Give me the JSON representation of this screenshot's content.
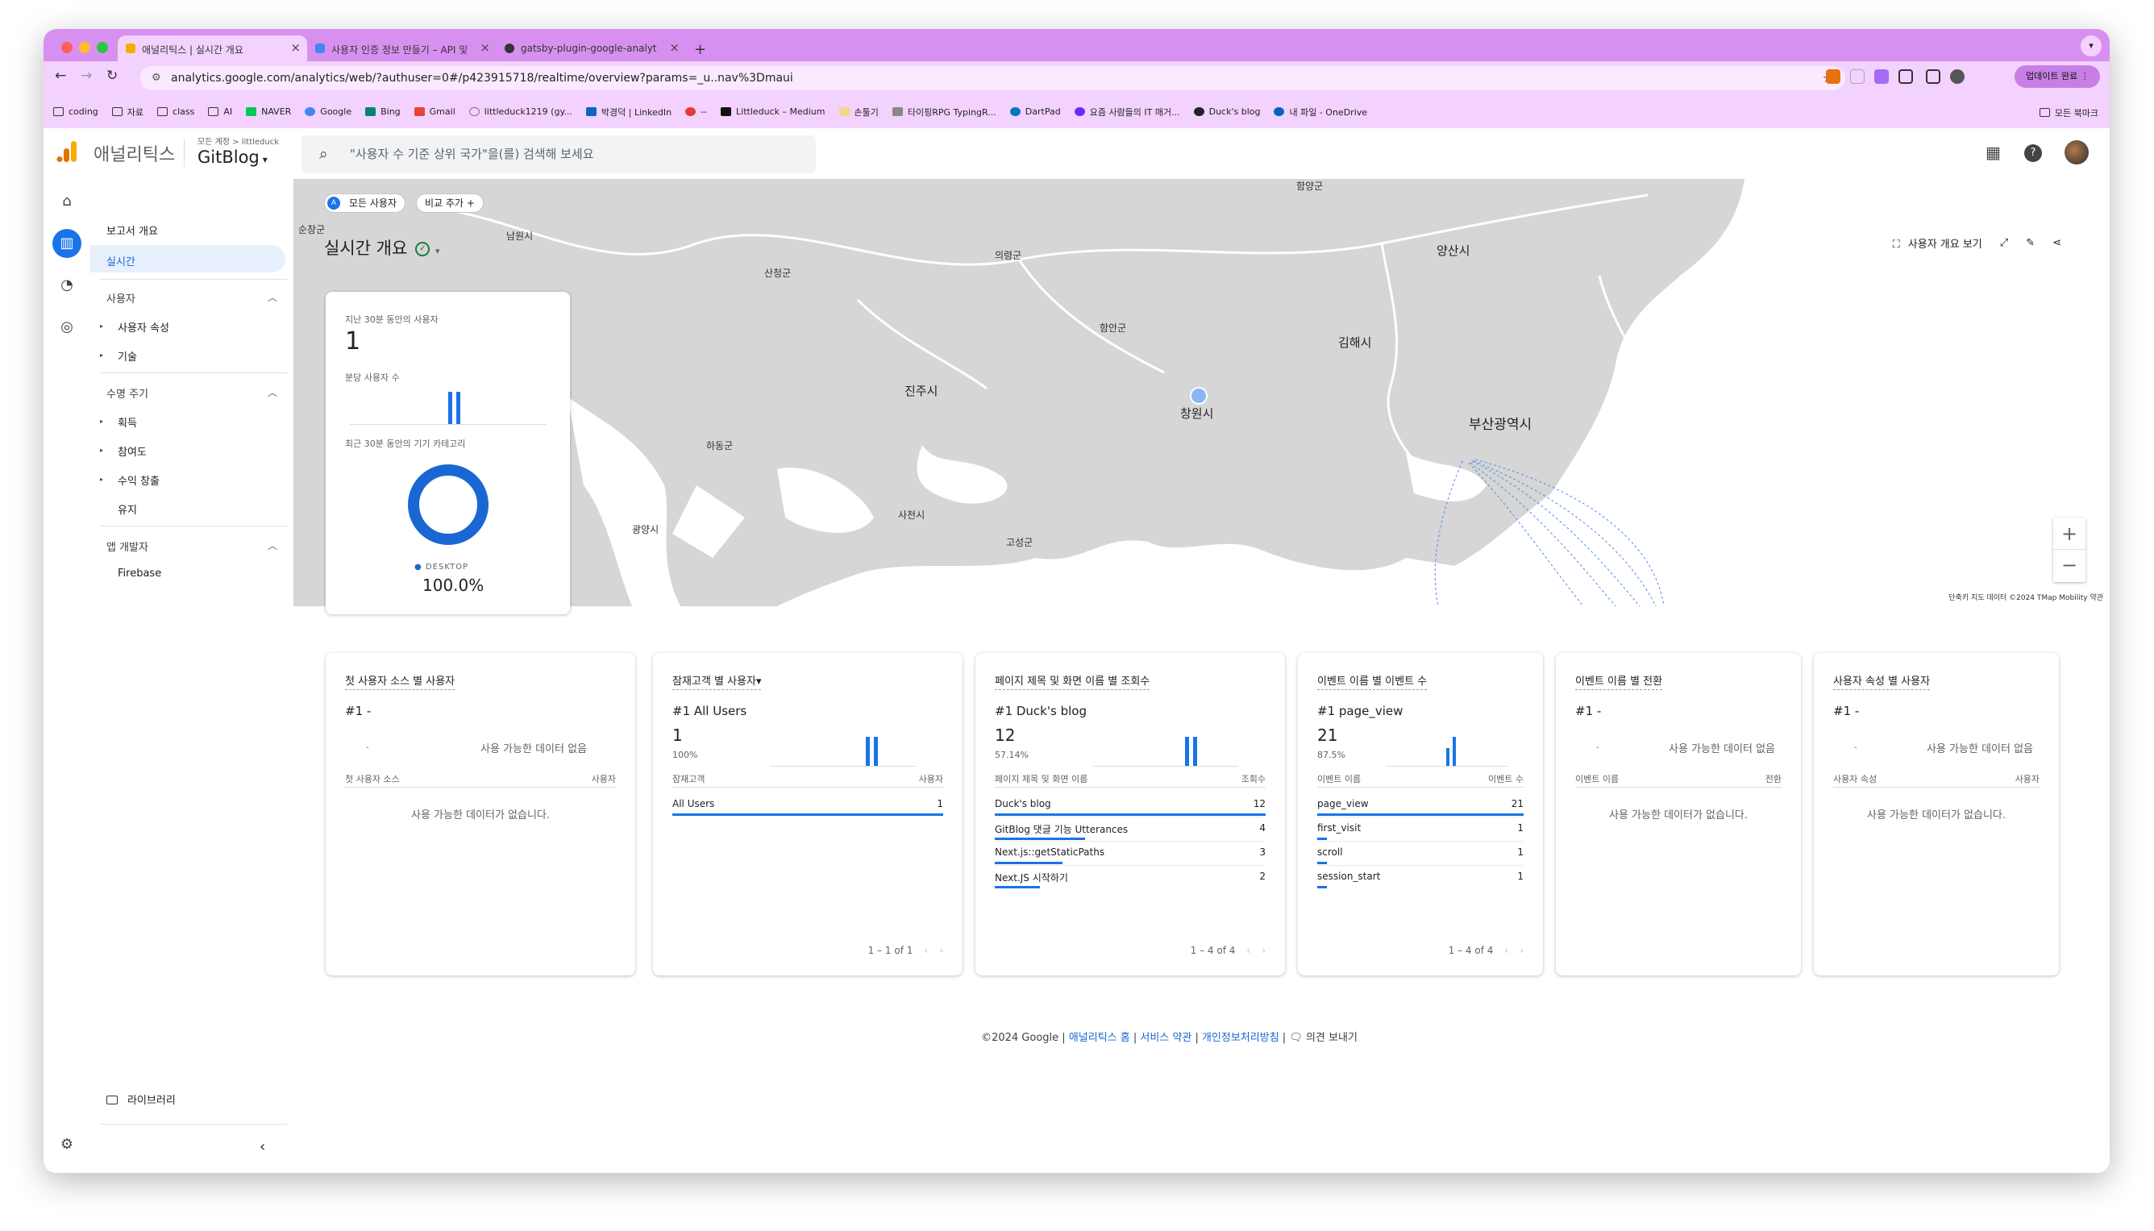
{
  "browser": {
    "tabs": [
      {
        "title": "애널리틱스 | 실시간 개요",
        "favicon_color": "#f9ab00"
      },
      {
        "title": "사용자 인증 정보 만들기 – API 및",
        "favicon_color": "#4285f4"
      },
      {
        "title": "gatsby-plugin-google-analyt",
        "favicon_color": "#333333"
      }
    ],
    "url": "analytics.google.com/analytics/web/?authuser=0#/p423915718/realtime/overview?params=_u..nav%3Dmaui",
    "update_label": "업데이트 완료",
    "bookmarks": [
      "coding",
      "자료",
      "class",
      "AI",
      "NAVER",
      "Google",
      "Bing",
      "Gmail",
      "littleduck1219 (gy...",
      "박경덕 | LinkedIn",
      "--",
      "Littleduck – Medium",
      "손툴기",
      "타이핑RPG TypingR...",
      "DartPad",
      "요즘 사람들의 IT 매거...",
      "Duck's blog",
      "내 파일 - OneDrive"
    ],
    "all_bookmarks": "모든 북마크"
  },
  "ga_header": {
    "app_name": "애널리틱스",
    "account_path": "모든 계정 > littleduck",
    "property": "GitBlog",
    "search_placeholder": "\"사용자 수 기준 상위 국가\"을(를) 검색해 보세요"
  },
  "sidebar": {
    "report_overview": "보고서 개요",
    "realtime": "실시간",
    "user_section": "사용자",
    "user_items": [
      "사용자 속성",
      "기술"
    ],
    "lifecycle_section": "수명 주기",
    "lifecycle_items": [
      "획득",
      "참여도",
      "수익 창출",
      "유지"
    ],
    "app_dev_section": "앱 개발자",
    "app_dev_items": [
      "Firebase"
    ],
    "library": "라이브러리"
  },
  "realtime": {
    "chip_all_users": "모든 사용자",
    "chip_add_compare": "비교 추가",
    "title": "실시간 개요",
    "view_user_overview": "사용자 개요 보기",
    "map_attribution": "단축키   지도 데이터 ©2024 TMap Mobility   약관",
    "map_places": [
      "순창군",
      "남원시",
      "함양군",
      "산청군",
      "의령군",
      "함안군",
      "양산시",
      "김해시",
      "진주시",
      "창원시",
      "부산광역시",
      "하동군",
      "사천시",
      "광양시",
      "고성군"
    ]
  },
  "users_card": {
    "label_30min": "지난 30분 동안의 사용자",
    "users_30min": "1",
    "label_per_minute": "분당 사용자 수",
    "label_device": "최근 30분 동안의 기기 카테고리",
    "device_name": "DESKTOP",
    "device_pct": "100.0%"
  },
  "cards": [
    {
      "title": "첫 사용자 소스 별 사용자",
      "rank": "#1  -",
      "dash": "-",
      "no_data": "사용 가능한 데이터 없음",
      "col1": "첫 사용자 소스",
      "col2": "사용자",
      "empty": "사용 가능한 데이터가 없습니다."
    },
    {
      "title": "잠재고객 별 사용자",
      "rank": "#1  All Users",
      "value": "1",
      "pct": "100%",
      "col1": "잠재고객",
      "col2": "사용자",
      "rows": [
        {
          "name": "All Users",
          "value": "1",
          "share": 1.0
        }
      ],
      "pager": "1 – 1 of 1"
    },
    {
      "title": "페이지 제목 및 화면 이름 별 조회수",
      "rank": "#1  Duck's blog",
      "value": "12",
      "pct": "57.14%",
      "col1": "페이지 제목 및 화면 이름",
      "col2": "조회수",
      "rows": [
        {
          "name": "Duck's blog",
          "value": "12",
          "share": 1.0
        },
        {
          "name": "GitBlog 댓글 기능 Utterances",
          "value": "4",
          "share": 0.333
        },
        {
          "name": "Next.js::getStaticPaths",
          "value": "3",
          "share": 0.25
        },
        {
          "name": "Next.JS 시작하기",
          "value": "2",
          "share": 0.167
        }
      ],
      "pager": "1 – 4 of 4"
    },
    {
      "title": "이벤트 이름 별 이벤트 수",
      "rank": "#1  page_view",
      "value": "21",
      "pct": "87.5%",
      "col1": "이벤트 이름",
      "col2": "이벤트 수",
      "rows": [
        {
          "name": "page_view",
          "value": "21",
          "share": 1.0
        },
        {
          "name": "first_visit",
          "value": "1",
          "share": 0.048
        },
        {
          "name": "scroll",
          "value": "1",
          "share": 0.048
        },
        {
          "name": "session_start",
          "value": "1",
          "share": 0.048
        }
      ],
      "pager": "1 – 4 of 4"
    },
    {
      "title": "이벤트 이름 별 전환",
      "rank": "#1  -",
      "dash": "-",
      "no_data": "사용 가능한 데이터 없음",
      "col1": "이벤트 이름",
      "col2": "전환",
      "empty": "사용 가능한 데이터가 없습니다."
    },
    {
      "title": "사용자 속성 별 사용자",
      "rank": "#1  -",
      "dash": "-",
      "no_data": "사용 가능한 데이터 없음",
      "col1": "사용자 속성",
      "col2": "사용자",
      "empty": "사용 가능한 데이터가 없습니다."
    }
  ],
  "footer": {
    "copyright": "©2024 Google |",
    "link_home": "애널리틱스 홈",
    "link_terms": "서비스 약관",
    "link_privacy": "개인정보처리방침",
    "feedback": "의견 보내기"
  },
  "colors": {
    "accent": "#1a73e8",
    "chrome": "#d890f0"
  }
}
